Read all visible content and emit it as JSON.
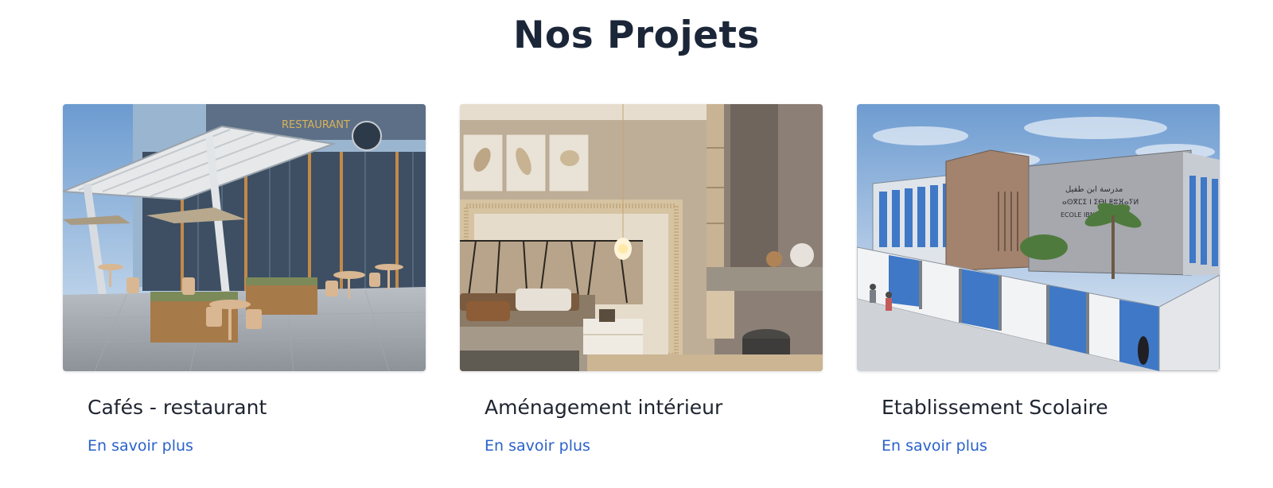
{
  "section": {
    "title": "Nos Projets"
  },
  "projects": [
    {
      "title": "Cafés - restaurant",
      "link_label": "En savoir plus",
      "image_name": "cafe-restaurant-terrace-image",
      "sign_text": "RESTAURANT"
    },
    {
      "title": "Aménagement intérieur",
      "link_label": "En savoir plus",
      "image_name": "interior-bedroom-image"
    },
    {
      "title": "Etablissement Scolaire",
      "link_label": "En savoir plus",
      "image_name": "school-building-sketch-image",
      "sign_text_line1": "مدرسة ابن طفيل",
      "sign_text_line2": "ⴰⵙⴳⵎⵉ ⵏ ⵉⴱⵏ ⵟⵓⴼⴰⵢⵍ",
      "sign_text_line3": "ECOLE IBN TOFAIL"
    }
  ],
  "colors": {
    "title": "#1b2638",
    "card_title": "#1e2430",
    "link": "#2a62c9"
  }
}
